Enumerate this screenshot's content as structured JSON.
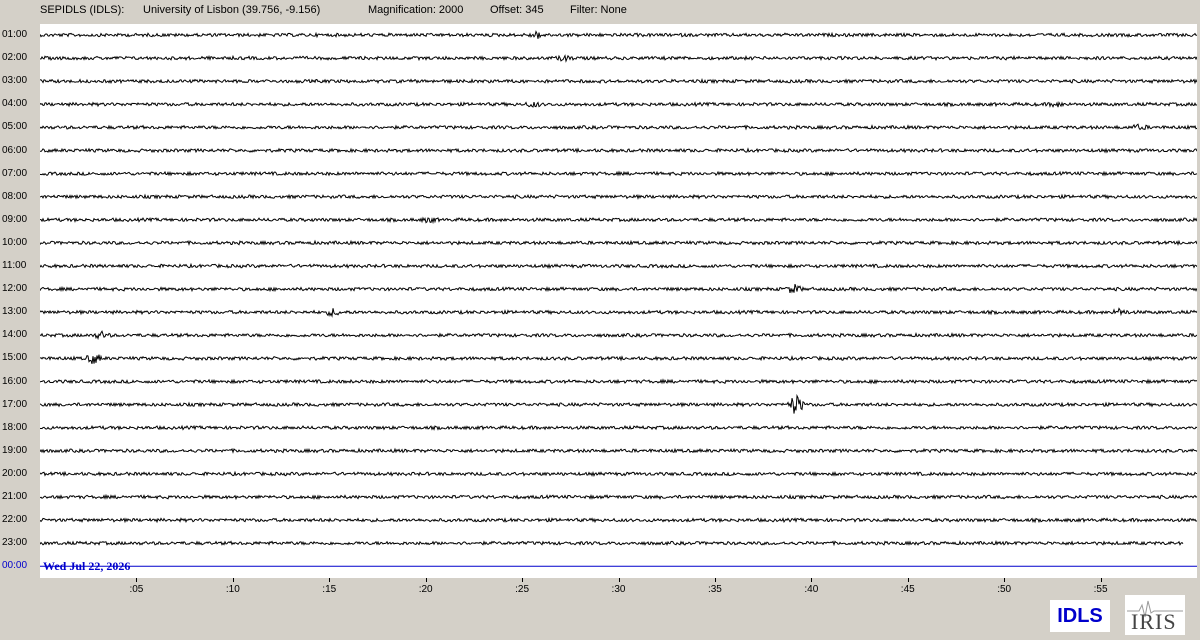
{
  "header": {
    "station": "SEPIDLS (IDLS):",
    "location": "University of Lisbon (39.756, -9.156)",
    "magnification": "Magnification: 2000",
    "offset": "Offset: 345",
    "filter": "Filter: None"
  },
  "date_label": "Wed Jul 22, 2026",
  "logos": {
    "idls": "IDLS",
    "iris": "IRIS"
  },
  "colors": {
    "trace": "#000000",
    "current_hour": "#0000cc",
    "background": "#d4d0c8",
    "plot_bg": "#ffffff"
  },
  "chart_data": {
    "type": "line",
    "title": "",
    "hour_labels": [
      "01:00",
      "02:00",
      "03:00",
      "04:00",
      "05:00",
      "06:00",
      "07:00",
      "08:00",
      "09:00",
      "10:00",
      "11:00",
      "12:00",
      "13:00",
      "14:00",
      "15:00",
      "16:00",
      "17:00",
      "18:00",
      "19:00",
      "20:00",
      "21:00",
      "22:00",
      "23:00",
      "00:00"
    ],
    "x_tick_labels": [
      ":05",
      ":10",
      ":15",
      ":20",
      ":25",
      ":30",
      ":35",
      ":40",
      ":45",
      ":50",
      ":55"
    ],
    "x_tick_minutes": [
      5,
      10,
      15,
      20,
      25,
      30,
      35,
      40,
      45,
      50,
      55
    ],
    "xlim": [
      0,
      60
    ],
    "partial_hour": {
      "label": "23:00",
      "end_minute": 59.3
    },
    "current_hour": {
      "label": "00:00",
      "end_minute": 60
    },
    "events": [
      {
        "hour": "01:00",
        "minute": 25.8,
        "amplitude": 3
      },
      {
        "hour": "02:00",
        "minute": 27.2,
        "amplitude": 2
      },
      {
        "hour": "04:00",
        "minute": 25.6,
        "amplitude": 2
      },
      {
        "hour": "04:00",
        "minute": 52.7,
        "amplitude": 2
      },
      {
        "hour": "05:00",
        "minute": 57.0,
        "amplitude": 2
      },
      {
        "hour": "09:00",
        "minute": 20.2,
        "amplitude": 2
      },
      {
        "hour": "12:00",
        "minute": 39.1,
        "amplitude": 4
      },
      {
        "hour": "13:00",
        "minute": 56.0,
        "amplitude": 3
      },
      {
        "hour": "13:00",
        "minute": 15.2,
        "amplitude": 3
      },
      {
        "hour": "14:00",
        "minute": 3.2,
        "amplitude": 3
      },
      {
        "hour": "15:00",
        "minute": 2.8,
        "amplitude": 5
      },
      {
        "hour": "17:00",
        "minute": 39.2,
        "amplitude": 10
      }
    ]
  }
}
